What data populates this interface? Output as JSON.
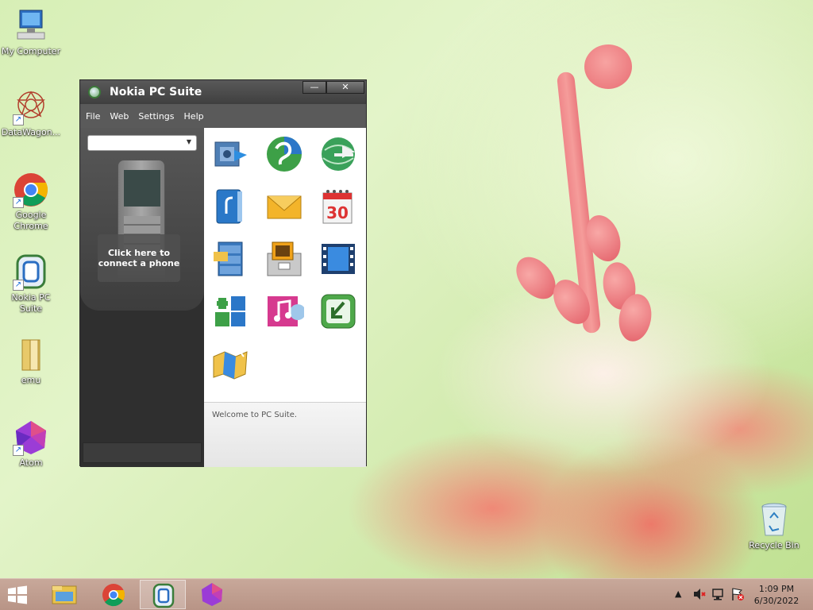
{
  "desktop": {
    "icons": [
      {
        "label": "My Computer"
      },
      {
        "label": "DataWagon..."
      },
      {
        "label": "Google Chrome"
      },
      {
        "label": "Nokia PC Suite"
      },
      {
        "label": "emu"
      },
      {
        "label": "Atom"
      },
      {
        "label": "Recycle Bin"
      }
    ]
  },
  "window": {
    "title": "Nokia PC Suite",
    "minimize_glyph": "—",
    "close_glyph": "✕",
    "menu": [
      "File",
      "Web",
      "Settings",
      "Help"
    ],
    "connect_line1": "Click here to",
    "connect_line2": "connect a phone",
    "combo_arrow": "▼",
    "welcome": "Welcome to PC Suite.",
    "tiles": [
      "backup-icon",
      "sync-icon",
      "connect-internet-icon",
      "contacts-icon",
      "messages-icon",
      "calendar-icon",
      "file-manager-icon",
      "photos-icon",
      "video-icon",
      "install-apps-icon",
      "music-icon",
      "update-software-icon",
      "maps-icon"
    ],
    "calendar_day": "30"
  },
  "taskbar": {
    "time": "1:09 PM",
    "date": "6/30/2022",
    "tray_chevron": "▲"
  },
  "colors": {
    "taskbar": "#b89486",
    "window_chrome": "#4a4a4a",
    "accent_blue": "#1e6fd9"
  }
}
